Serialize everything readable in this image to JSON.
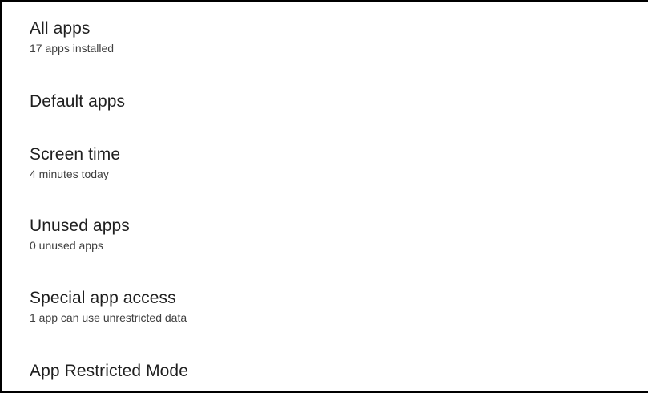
{
  "settings": {
    "items": [
      {
        "title": "All apps",
        "summary": "17 apps installed"
      },
      {
        "title": "Default apps",
        "summary": ""
      },
      {
        "title": "Screen time",
        "summary": "4 minutes today"
      },
      {
        "title": "Unused apps",
        "summary": "0 unused apps"
      },
      {
        "title": "Special app access",
        "summary": "1 app can use unrestricted data"
      },
      {
        "title": "App Restricted Mode",
        "summary": ""
      }
    ]
  }
}
